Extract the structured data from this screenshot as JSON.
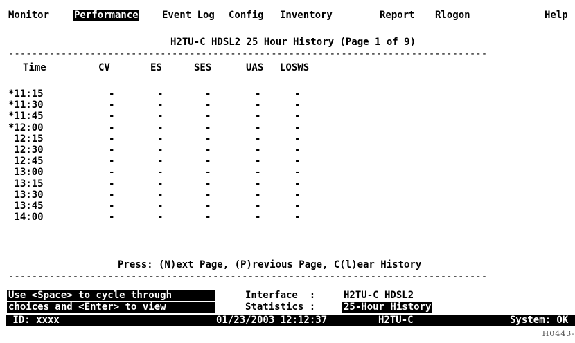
{
  "menu": {
    "items": [
      "Monitor",
      "Performance",
      "Event Log",
      "Config",
      "Inventory",
      "Report",
      "Rlogon"
    ],
    "help": "Help",
    "selected_index": 1
  },
  "page_title": "H2TU-C HDSL2 25 Hour History (Page 1 of 9)",
  "separator": "----------------------------------------------------------------------------------",
  "table": {
    "columns": [
      "Time",
      "CV",
      "ES",
      "SES",
      "UAS",
      "LOSWS"
    ],
    "rows": [
      {
        "time": "*11:15",
        "cv": "-",
        "es": "-",
        "ses": "-",
        "uas": "-",
        "losws": "-"
      },
      {
        "time": "*11:30",
        "cv": "-",
        "es": "-",
        "ses": "-",
        "uas": "-",
        "losws": "-"
      },
      {
        "time": "*11:45",
        "cv": "-",
        "es": "-",
        "ses": "-",
        "uas": "-",
        "losws": "-"
      },
      {
        "time": "*12:00",
        "cv": "-",
        "es": "-",
        "ses": "-",
        "uas": "-",
        "losws": "-"
      },
      {
        "time": " 12:15",
        "cv": "-",
        "es": "-",
        "ses": "-",
        "uas": "-",
        "losws": "-"
      },
      {
        "time": " 12:30",
        "cv": "-",
        "es": "-",
        "ses": "-",
        "uas": "-",
        "losws": "-"
      },
      {
        "time": " 12:45",
        "cv": "-",
        "es": "-",
        "ses": "-",
        "uas": "-",
        "losws": "-"
      },
      {
        "time": " 13:00",
        "cv": "-",
        "es": "-",
        "ses": "-",
        "uas": "-",
        "losws": "-"
      },
      {
        "time": " 13:15",
        "cv": "-",
        "es": "-",
        "ses": "-",
        "uas": "-",
        "losws": "-"
      },
      {
        "time": " 13:30",
        "cv": "-",
        "es": "-",
        "ses": "-",
        "uas": "-",
        "losws": "-"
      },
      {
        "time": " 13:45",
        "cv": "-",
        "es": "-",
        "ses": "-",
        "uas": "-",
        "losws": "-"
      },
      {
        "time": " 14:00",
        "cv": "-",
        "es": "-",
        "ses": "-",
        "uas": "-",
        "losws": "-"
      }
    ]
  },
  "press_hint": "Press: (N)ext Page, (P)revious Page, C(l)ear History",
  "help_text": {
    "line1": "Use <Space> to cycle through",
    "line2": "choices and <Enter> to view"
  },
  "fields": {
    "interface_label": "Interface  :",
    "interface_value": "H2TU-C HDSL2",
    "statistics_label": "Statistics :",
    "statistics_value": "25-Hour History"
  },
  "status": {
    "id": " ID: xxxx",
    "datetime": "01/23/2003 12:12:37",
    "unit": "H2TU-C",
    "system": "System: OK"
  },
  "figure_code": "H0443-"
}
